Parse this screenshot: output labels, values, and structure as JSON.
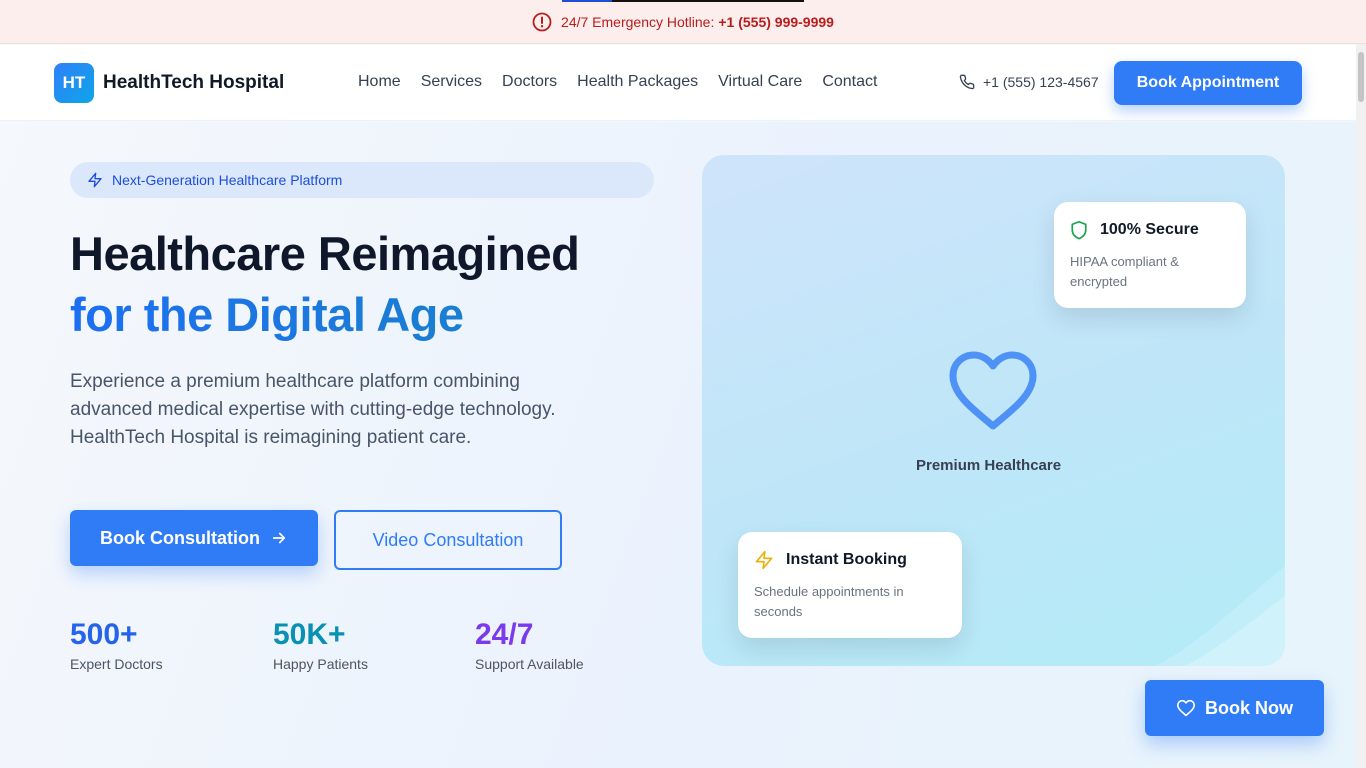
{
  "emergency": {
    "text": "24/7 Emergency Hotline:",
    "phone": "+1 (555) 999-9999",
    "icon": "alert-circle-icon"
  },
  "header": {
    "logo_badge": "HT",
    "logo_text": "HealthTech Hospital",
    "nav": [
      "Home",
      "Services",
      "Doctors",
      "Health Packages",
      "Virtual Care",
      "Contact"
    ],
    "phone": "+1 (555) 123-4567",
    "cta": "Book Appointment"
  },
  "hero": {
    "pill": "Next-Generation Healthcare Platform",
    "title_line1": "Healthcare Reimagined",
    "title_line2": "for the Digital Age",
    "description": "Experience a premium healthcare platform combining advanced medical expertise with cutting-edge technology. HealthTech Hospital is reimagining patient care.",
    "primary_cta": "Book Consultation",
    "secondary_cta": "Video Consultation",
    "stats": [
      {
        "value": "500+",
        "label": "Expert Doctors",
        "color": "#2563eb"
      },
      {
        "value": "50K+",
        "label": "Happy Patients",
        "color": "#0891b2"
      },
      {
        "value": "24/7",
        "label": "Support Available",
        "color": "#7c3aed"
      }
    ]
  },
  "visual": {
    "label": "Premium Healthcare",
    "secure": {
      "title": "100% Secure",
      "desc": "HIPAA compliant & encrypted"
    },
    "booking": {
      "title": "Instant Booking",
      "desc": "Schedule appointments in seconds"
    }
  },
  "floating_cta": "Book Now",
  "colors": {
    "primary": "#2f7cf6",
    "emergency": "#b91c1c",
    "secure": "#16a34a",
    "booking": "#eab308"
  }
}
